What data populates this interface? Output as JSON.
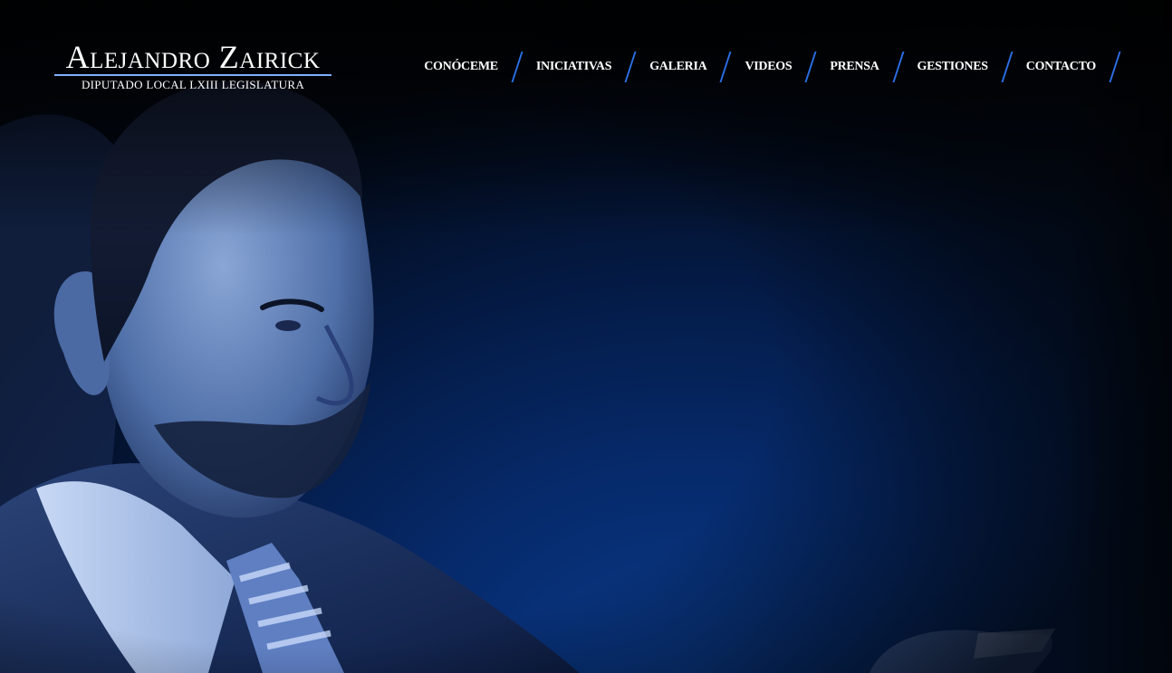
{
  "brand": {
    "name": "Alejandro Zairick",
    "subtitle": "DIPUTADO LOCAL LXIII LEGISLATURA"
  },
  "nav": {
    "items": [
      {
        "label": "CONÓCEME"
      },
      {
        "label": "INICIATIVAS"
      },
      {
        "label": "GALERIA"
      },
      {
        "label": "VIDEOS"
      },
      {
        "label": "PRENSA"
      },
      {
        "label": "GESTIONES"
      },
      {
        "label": "CONTACTO"
      }
    ]
  },
  "colors": {
    "background": "#041a44",
    "accent": "#2f7bff",
    "text": "#ffffff"
  }
}
